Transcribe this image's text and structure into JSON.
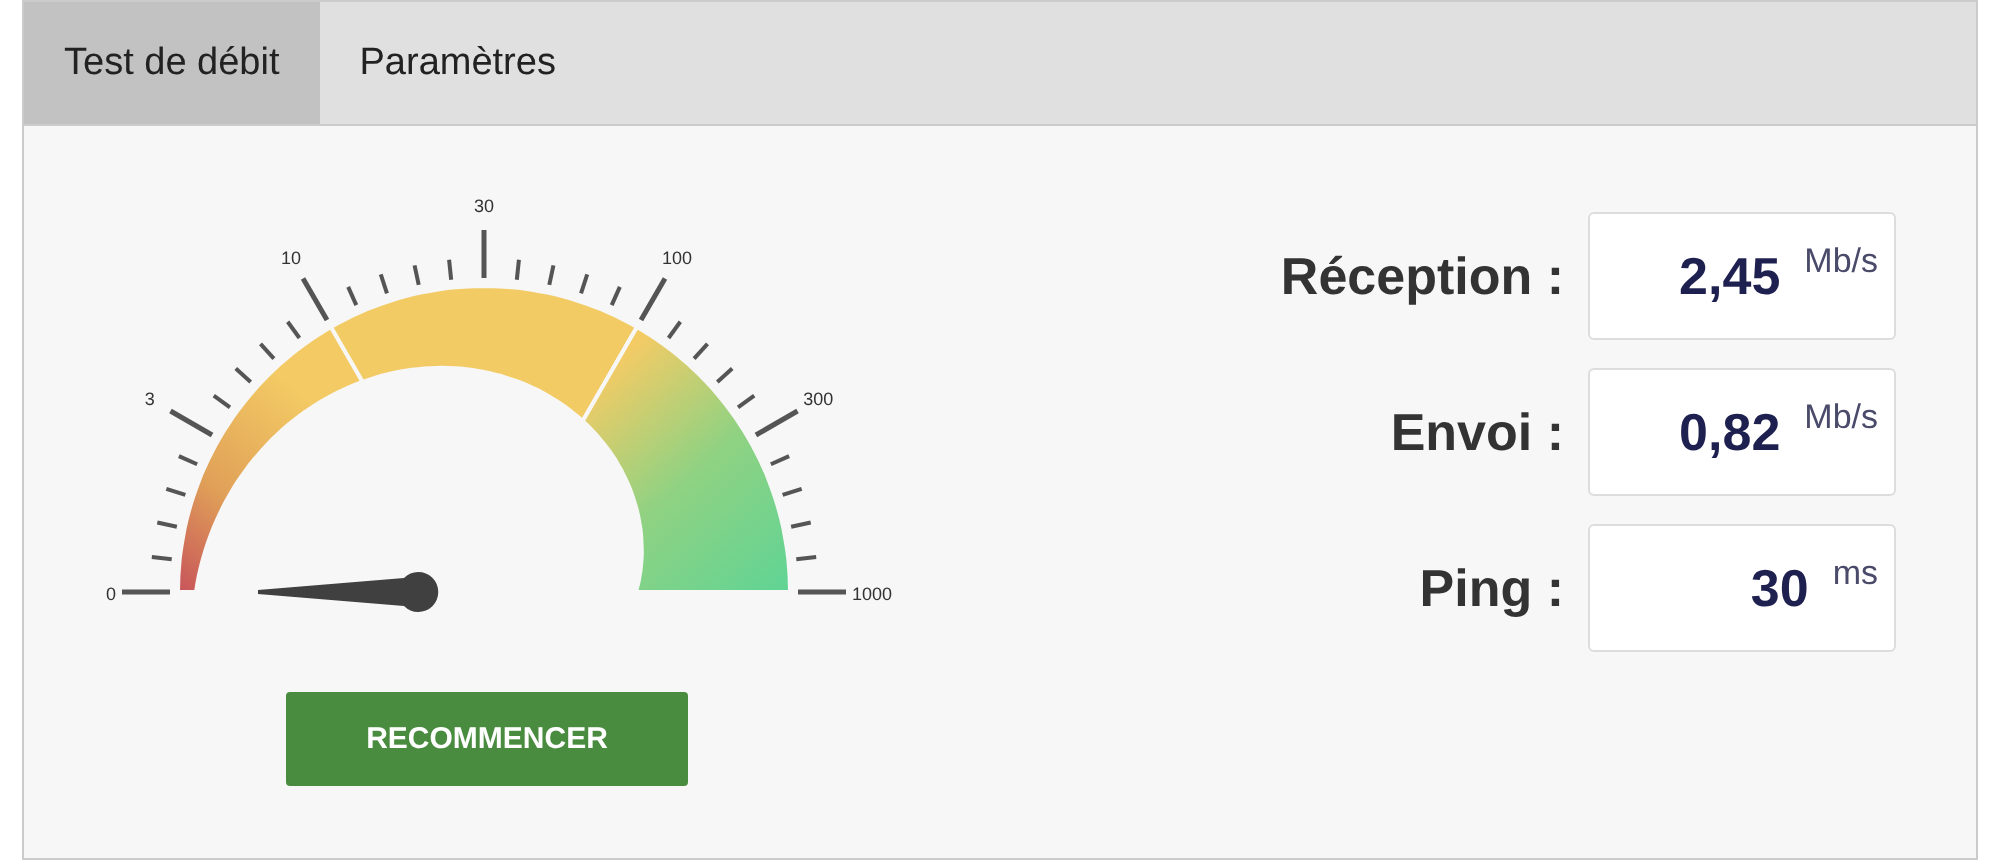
{
  "tabs": [
    {
      "label": "Test de débit",
      "selected": true
    },
    {
      "label": "Paramètres",
      "selected": false
    }
  ],
  "gauge": {
    "scale_labels": [
      "0",
      "3",
      "10",
      "30",
      "100",
      "300",
      "1000"
    ]
  },
  "button": "RECOMMENCER",
  "results": [
    {
      "label": "Réception :",
      "value": "2,45",
      "unit": "Mb/s"
    },
    {
      "label": "Envoi :",
      "value": "0,82",
      "unit": "Mb/s"
    },
    {
      "label": "Ping :",
      "value": "30",
      "unit": "ms"
    }
  ]
}
